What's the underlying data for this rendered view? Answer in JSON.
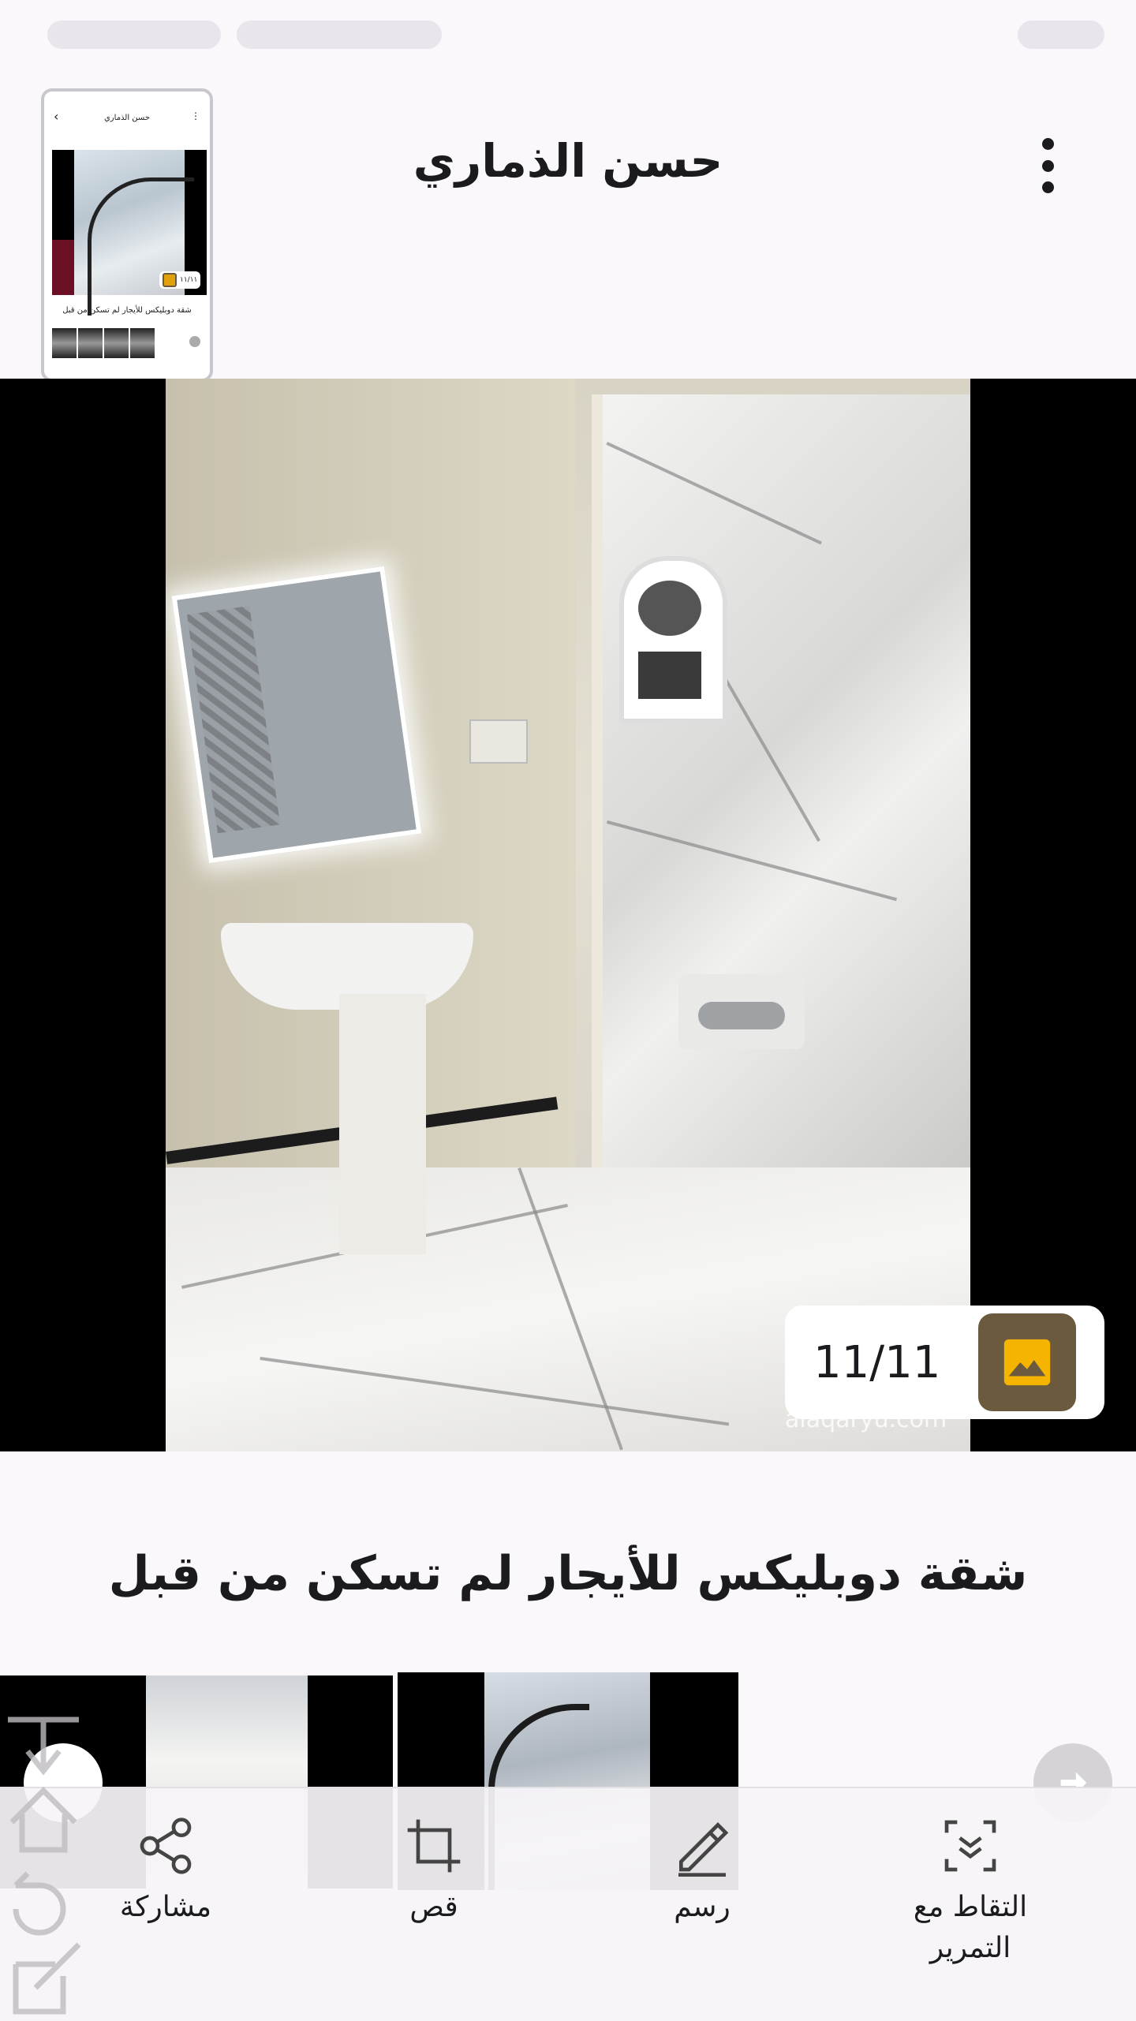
{
  "header": {
    "title": "حسن الذماري"
  },
  "preview_thumbnail": {
    "title": "حسن الذماري",
    "counter": "١١/١١",
    "caption": "شقة دوبليكس للأيجار  لم تسكن من قبل"
  },
  "photo": {
    "counter": "11/11",
    "watermark": "alaqaryu.com"
  },
  "listing": {
    "caption": "شقة دوبليكس للأيجار  لم تسكن من قبل"
  },
  "toolbar": {
    "share_label": "مشاركة",
    "crop_label": "قص",
    "draw_label": "رسم",
    "scroll_capture_label": "التقاط مع التمرير"
  },
  "icons": {
    "menu": "more-vert-icon",
    "image": "image-icon",
    "share": "share-icon",
    "crop": "crop-icon",
    "draw": "pencil-icon",
    "scroll_capture": "scroll-capture-icon",
    "next": "arrow-right-icon"
  },
  "colors": {
    "background": "#fbf8fc",
    "image_badge": "#6b5a3d",
    "image_badge_accent": "#f4b400"
  }
}
